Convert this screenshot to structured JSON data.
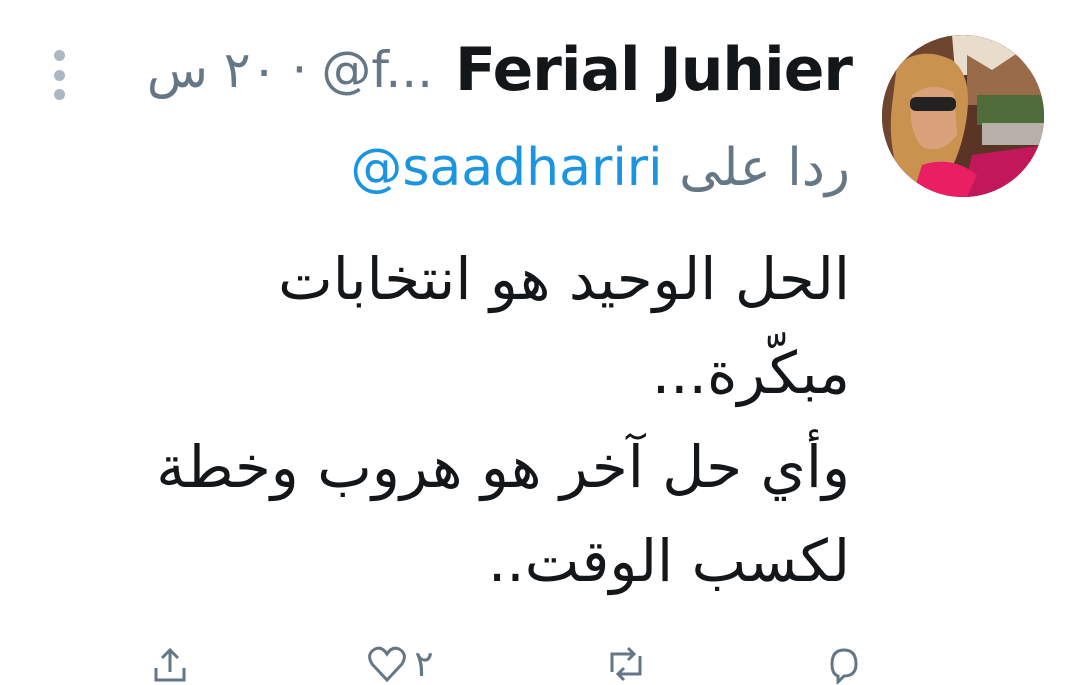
{
  "tweet": {
    "author": {
      "display_name": "Ferial Juhier",
      "handle": "@f...",
      "avatar_icon": "avatar-photo"
    },
    "time": "٢٠ س",
    "separator": "·",
    "reply_to": {
      "prefix": "ردا على",
      "mention": "@saadhariri"
    },
    "text_lines": [
      "الحل الوحيد هو انتخابات",
      "مبكّرة...",
      "وأي حل آخر هو هروب وخطة",
      "لكسب الوقت.."
    ],
    "actions": [
      {
        "icon": "reply-icon",
        "count": ""
      },
      {
        "icon": "retweet-icon",
        "count": ""
      },
      {
        "icon": "like-icon",
        "count": "٢"
      },
      {
        "icon": "share-icon",
        "count": ""
      }
    ],
    "more_icon": "more-vertical-icon"
  },
  "colors": {
    "text_primary": "#14171a",
    "text_secondary": "#657786",
    "link": "#1b95e0",
    "icon_muted": "#aab8c2"
  }
}
